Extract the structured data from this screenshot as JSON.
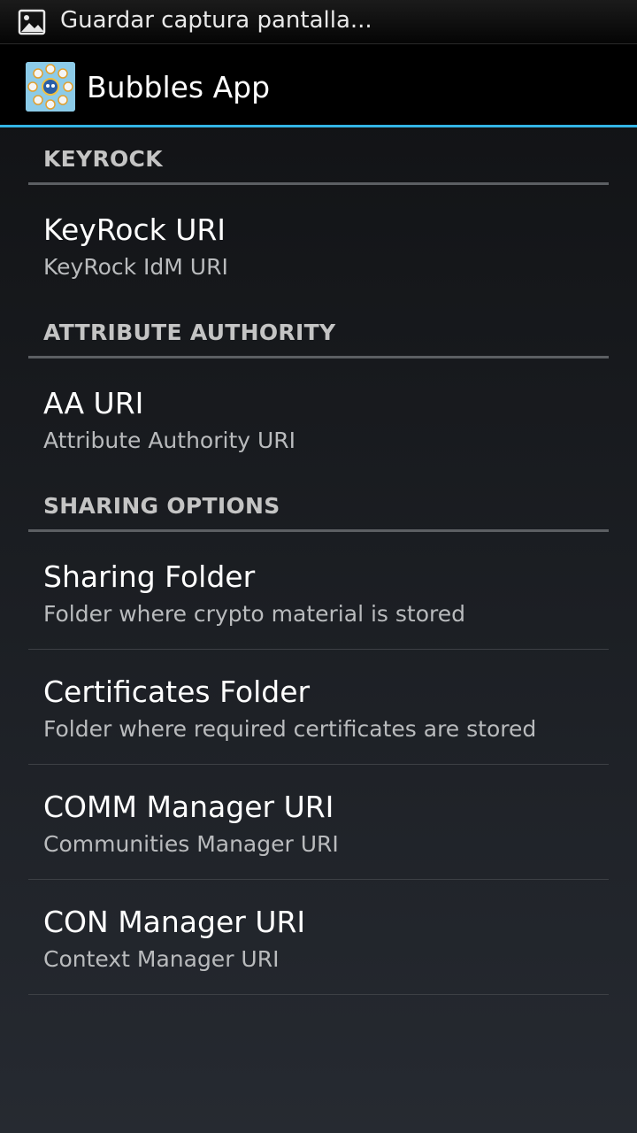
{
  "status_bar": {
    "notification_icon": "image-icon",
    "notification_text": "Guardar captura pantalla..."
  },
  "action_bar": {
    "app_icon": "bubbles-app-icon",
    "title": "Bubbles App",
    "accent_color": "#33b5e5"
  },
  "preferences": {
    "keyrock": {
      "category": "KEYROCK",
      "uri_title": "KeyRock URI",
      "uri_summary": "KeyRock IdM URI"
    },
    "attribute_authority": {
      "category": "ATTRIBUTE AUTHORITY",
      "uri_title": "AA URI",
      "uri_summary": "Attribute Authority URI"
    },
    "sharing_options": {
      "category": "SHARING OPTIONS",
      "items": [
        {
          "title": "Sharing Folder",
          "summary": "Folder where crypto material is stored"
        },
        {
          "title": "Certificates Folder",
          "summary": "Folder where required certificates are stored"
        },
        {
          "title": "COMM Manager URI",
          "summary": "Communities Manager URI"
        },
        {
          "title": "CON Manager URI",
          "summary": "Context Manager URI"
        }
      ]
    }
  }
}
